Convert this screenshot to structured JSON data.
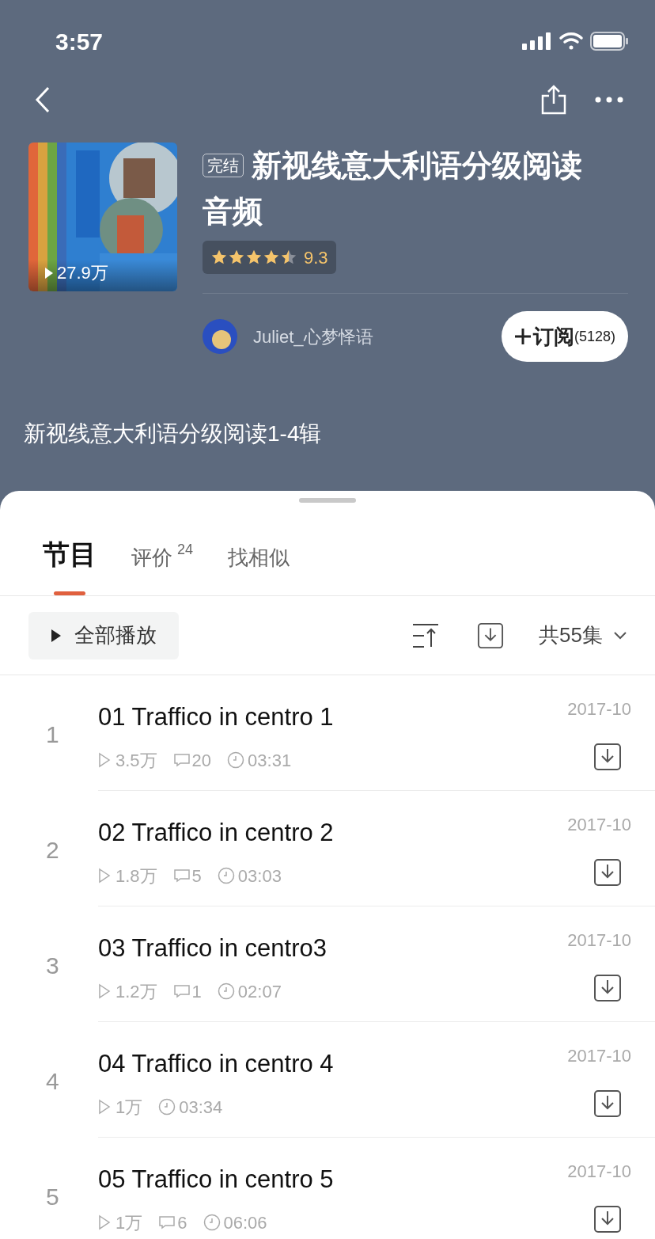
{
  "status_bar": {
    "time": "3:57"
  },
  "album": {
    "status_tag": "完结",
    "title": "新视线意大利语分级阅读音频",
    "play_count": "27.9万",
    "stars": 4.5,
    "score": "9.3",
    "author": "Juliet_心梦怿语",
    "subscribe": {
      "label": "订阅",
      "count": "(5128)"
    },
    "description": "新视线意大利语分级阅读1-4辑"
  },
  "tabs": [
    {
      "label": "节目",
      "selected": true
    },
    {
      "label": "评价",
      "badge": "24",
      "selected": false
    },
    {
      "label": "找相似",
      "selected": false
    }
  ],
  "toolbar": {
    "play_all": "全部播放",
    "episode_count": "共55集"
  },
  "episodes": [
    {
      "index": "1",
      "title": "01 Traffico in centro 1",
      "date": "2017-10",
      "plays": "3.5万",
      "comments": "20",
      "duration": "03:31"
    },
    {
      "index": "2",
      "title": "02 Traffico in centro 2",
      "date": "2017-10",
      "plays": "1.8万",
      "comments": "5",
      "duration": "03:03"
    },
    {
      "index": "3",
      "title": "03 Traffico in centro3",
      "date": "2017-10",
      "plays": "1.2万",
      "comments": "1",
      "duration": "02:07"
    },
    {
      "index": "4",
      "title": "04 Traffico in centro 4",
      "date": "2017-10",
      "plays": "1万",
      "duration": "03:34"
    },
    {
      "index": "5",
      "title": "05 Traffico in centro 5",
      "date": "2017-10",
      "plays": "1万",
      "comments": "6",
      "duration": "06:06"
    }
  ]
}
